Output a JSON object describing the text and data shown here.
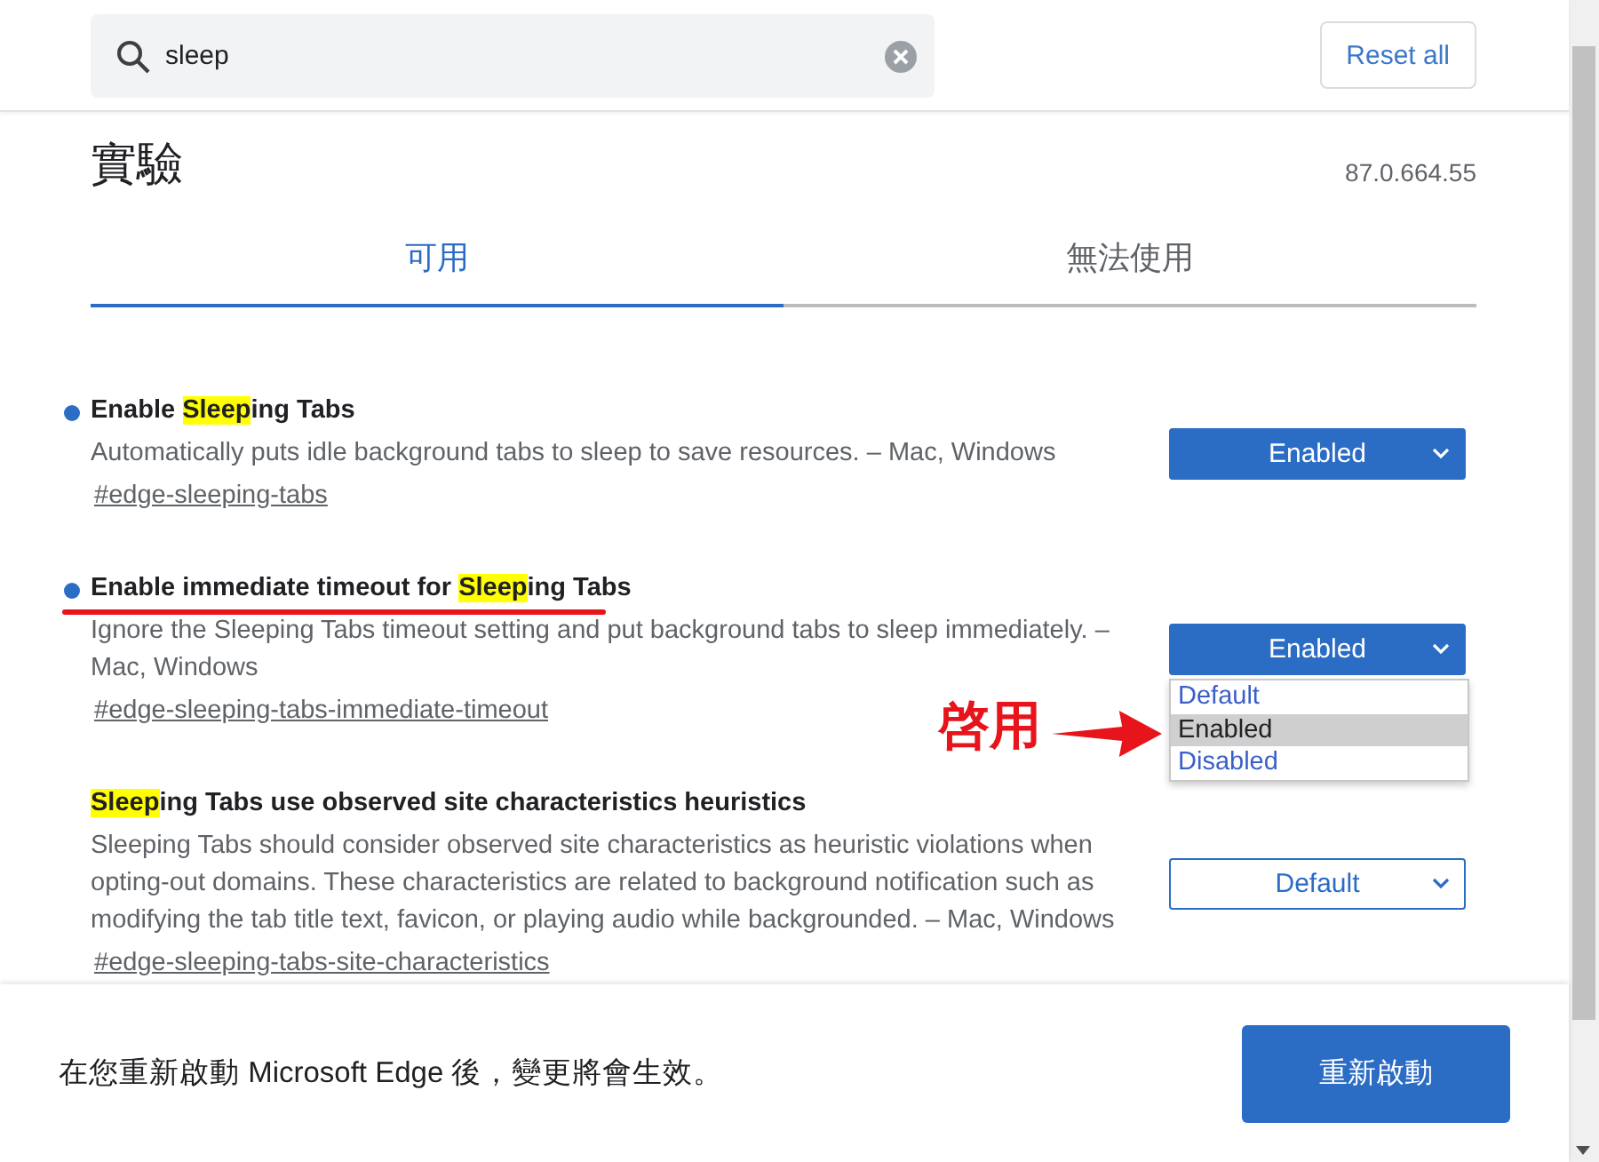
{
  "search": {
    "value": "sleep"
  },
  "reset_button": "Reset all",
  "title": "實驗",
  "version": "87.0.664.55",
  "tabs": [
    {
      "label": "可用",
      "selected": true
    },
    {
      "label": "無法使用",
      "selected": false
    }
  ],
  "flags": [
    {
      "title_parts": [
        {
          "text": "Enable ",
          "highlight": false
        },
        {
          "text": "Sleep",
          "highlight": true
        },
        {
          "text": "ing Tabs",
          "highlight": false
        }
      ],
      "modified": true,
      "description": "Automatically puts idle background tabs to sleep to save resources. – Mac, Windows",
      "link": "#edge-sleeping-tabs",
      "select": {
        "value": "Enabled",
        "modified": true
      }
    },
    {
      "title_parts": [
        {
          "text": "Enable immediate timeout for ",
          "highlight": false
        },
        {
          "text": "Sleep",
          "highlight": true
        },
        {
          "text": "ing Tabs",
          "highlight": false
        }
      ],
      "modified": true,
      "description": "Ignore the Sleeping Tabs timeout setting and put background tabs to sleep immediately. – Mac, Windows",
      "link": "#edge-sleeping-tabs-immediate-timeout",
      "select": {
        "value": "Enabled",
        "modified": true,
        "open": true,
        "options": [
          {
            "label": "Default",
            "selected": false
          },
          {
            "label": "Enabled",
            "selected": true
          },
          {
            "label": "Disabled",
            "selected": false
          }
        ]
      },
      "annotation": {
        "label": "啓用"
      }
    },
    {
      "title_parts": [
        {
          "text": "Sleep",
          "highlight": true
        },
        {
          "text": "ing Tabs use observed site characteristics heuristics",
          "highlight": false
        }
      ],
      "modified": false,
      "description": "Sleeping Tabs should consider observed site characteristics as heuristic violations when opting-out domains. These characteristics are related to background notification such as modifying the tab title text, favicon, or playing audio while backgrounded. – Mac, Windows",
      "link": "#edge-sleeping-tabs-site-characteristics",
      "select": {
        "value": "Default",
        "modified": false
      }
    }
  ],
  "footer": {
    "message": "在您重新啟動 Microsoft Edge 後，變更將會生效。",
    "button": "重新啟動"
  }
}
